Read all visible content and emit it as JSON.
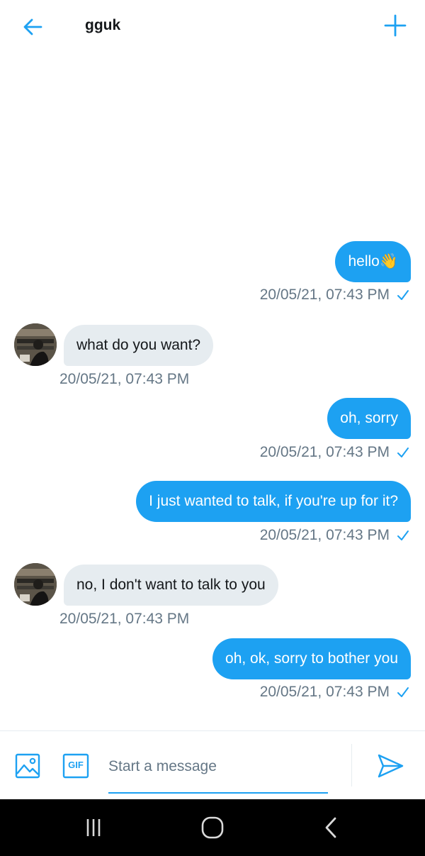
{
  "header": {
    "title": "gguk"
  },
  "colors": {
    "accent": "#1da1f2",
    "incoming_bubble": "#e6ecf0",
    "meta_text": "#657786"
  },
  "messages": [
    {
      "direction": "outgoing",
      "text": "hello👋",
      "timestamp": "20/05/21, 07:43 PM",
      "read": true
    },
    {
      "direction": "incoming",
      "text": "what do you want?",
      "timestamp": "20/05/21, 07:43 PM"
    },
    {
      "direction": "outgoing",
      "text": "oh, sorry",
      "timestamp": "20/05/21, 07:43 PM",
      "read": true
    },
    {
      "direction": "outgoing",
      "text": "I just wanted to talk, if you're up for it?",
      "timestamp": "20/05/21, 07:43 PM",
      "read": true
    },
    {
      "direction": "incoming",
      "text": "no, I don't want to talk to you",
      "timestamp": "20/05/21, 07:43 PM"
    },
    {
      "direction": "outgoing",
      "text": "oh, ok, sorry to bother you",
      "timestamp": "20/05/21, 07:43 PM",
      "read": true
    }
  ],
  "composer": {
    "placeholder": "Start a message",
    "gif_label": "GIF"
  },
  "icons": {
    "back": "arrow-left-icon",
    "new": "plus-icon",
    "media": "image-icon",
    "gif": "gif-icon",
    "send": "send-icon",
    "read": "checkmark-icon",
    "nav_recents": "recent-apps-icon",
    "nav_home": "home-icon",
    "nav_back": "back-chevron-icon"
  }
}
